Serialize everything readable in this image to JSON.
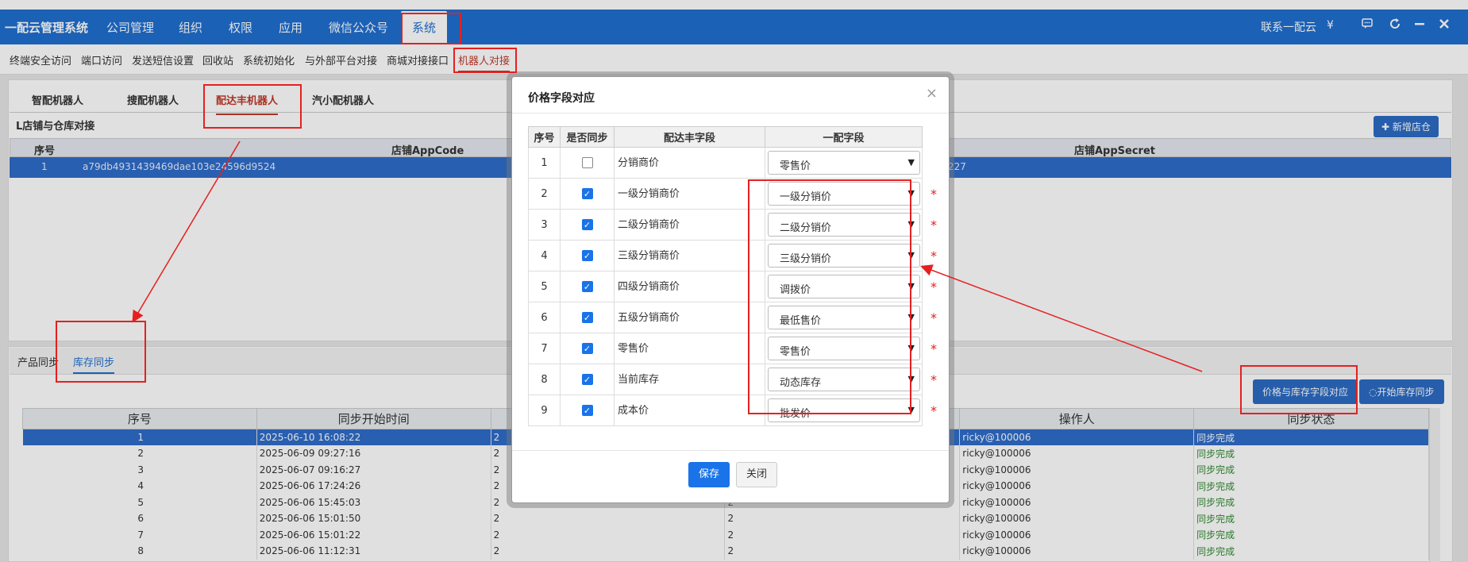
{
  "topnav": {
    "brand": "一配云管理系统",
    "items": [
      "公司管理",
      "组织",
      "权限",
      "应用",
      "微信公众号",
      "系统"
    ],
    "right_contact": "联系一配云",
    "right_currency": "¥",
    "right_icons": [
      "chat-icon",
      "refresh-icon",
      "minimize-icon",
      "close-icon"
    ]
  },
  "subnav": {
    "items": [
      "终端安全访问",
      "端口访问",
      "发送短信设置",
      "回收站",
      "系统初始化",
      "与外部平台对接",
      "商城对接接口",
      "机器人对接"
    ]
  },
  "robot_tabs": [
    "智配机器人",
    "搜配机器人",
    "配达丰机器人",
    "汽小配机器人"
  ],
  "store": {
    "title": "L店铺与仓库对接",
    "add_button": "新增店仓",
    "columns": [
      "序号",
      "店铺AppCode",
      "店铺AppSecret"
    ],
    "row": {
      "index": "1",
      "app_code": "a79db4931439469dae103e24596d9524",
      "app_secret_tail": "227"
    }
  },
  "sync_tabs": [
    "产品同步",
    "库存同步"
  ],
  "actions": {
    "field_map_button": "价格与库存字段对应",
    "start_sync_button": "开始库存同步"
  },
  "sync_table": {
    "columns": [
      "序号",
      "同步开始时间",
      "",
      "",
      "操作人",
      "同步状态"
    ],
    "rows": [
      {
        "index": "1",
        "start": "2025-06-10 16:08:22",
        "c3": "2",
        "c4": "2",
        "operator": "ricky@100006",
        "status": "同步完成"
      },
      {
        "index": "2",
        "start": "2025-06-09 09:27:16",
        "c3": "2",
        "c4": "2",
        "operator": "ricky@100006",
        "status": "同步完成"
      },
      {
        "index": "3",
        "start": "2025-06-07 09:16:27",
        "c3": "2",
        "c4": "2",
        "operator": "ricky@100006",
        "status": "同步完成"
      },
      {
        "index": "4",
        "start": "2025-06-06 17:24:26",
        "c3": "2",
        "c4": "2",
        "operator": "ricky@100006",
        "status": "同步完成"
      },
      {
        "index": "5",
        "start": "2025-06-06 15:45:03",
        "c3": "2",
        "c4": "2",
        "operator": "ricky@100006",
        "status": "同步完成"
      },
      {
        "index": "6",
        "start": "2025-06-06 15:01:50",
        "c3": "2",
        "c4": "2",
        "operator": "ricky@100006",
        "status": "同步完成"
      },
      {
        "index": "7",
        "start": "2025-06-06 15:01:22",
        "c3": "2",
        "c4": "2",
        "operator": "ricky@100006",
        "status": "同步完成"
      },
      {
        "index": "8",
        "start": "2025-06-06 11:12:31",
        "c3": "2",
        "c4": "2",
        "operator": "ricky@100006",
        "status": "同步完成"
      }
    ]
  },
  "modal": {
    "title": "价格字段对应",
    "close": "×",
    "columns": [
      "序号",
      "是否同步",
      "配达丰字段",
      "一配字段"
    ],
    "rows": [
      {
        "index": "1",
        "sync": false,
        "source": "分销商价",
        "target": "零售价",
        "required": false
      },
      {
        "index": "2",
        "sync": true,
        "source": "一级分销商价",
        "target": "一级分销价",
        "required": true
      },
      {
        "index": "3",
        "sync": true,
        "source": "二级分销商价",
        "target": "二级分销价",
        "required": true
      },
      {
        "index": "4",
        "sync": true,
        "source": "三级分销商价",
        "target": "三级分销价",
        "required": true
      },
      {
        "index": "5",
        "sync": true,
        "source": "四级分销商价",
        "target": "调拨价",
        "required": true
      },
      {
        "index": "6",
        "sync": true,
        "source": "五级分销商价",
        "target": "最低售价",
        "required": true
      },
      {
        "index": "7",
        "sync": true,
        "source": "零售价",
        "target": "零售价",
        "required": true
      },
      {
        "index": "8",
        "sync": true,
        "source": "当前库存",
        "target": "动态库存",
        "required": true
      },
      {
        "index": "9",
        "sync": true,
        "source": "成本价",
        "target": "批发价",
        "required": true
      }
    ],
    "required_mark": "*",
    "save_button": "保存",
    "close_button": "关闭"
  },
  "colors": {
    "primary": "#1f6fd0",
    "annotation": "#e52020",
    "success": "#2e8b2e"
  }
}
